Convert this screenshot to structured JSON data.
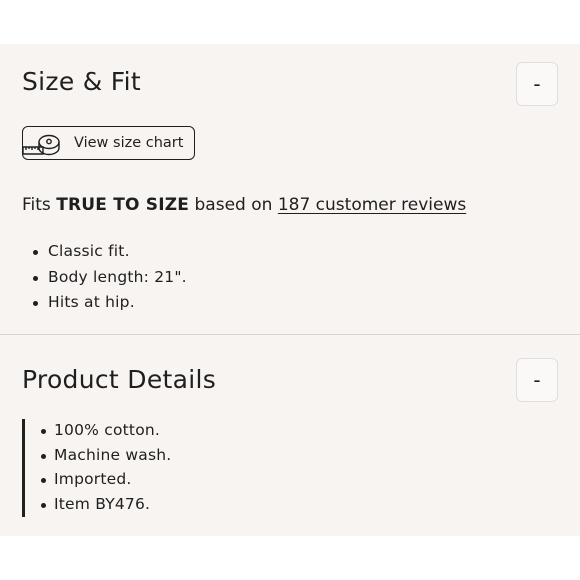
{
  "size_fit": {
    "title": "Size & Fit",
    "toggle_symbol": "-",
    "size_chart_label": "View size chart",
    "fit_prefix": "Fits",
    "fit_value": "TRUE TO SIZE",
    "fit_middle": "based on",
    "reviews_link": "187 customer reviews",
    "bullets": [
      "Classic fit.",
      "Body length: 21\".",
      "Hits at hip."
    ]
  },
  "product_details": {
    "title": "Product Details",
    "toggle_symbol": "-",
    "bullets": [
      "100% cotton.",
      "Machine wash.",
      "Imported.",
      "Item BY476."
    ]
  },
  "colors": {
    "panel_background": "#f8f4f1",
    "text": "#1f1f1f",
    "divider": "#d9d4d1"
  },
  "icons": {
    "size_chart": "measuring-tape-icon"
  }
}
